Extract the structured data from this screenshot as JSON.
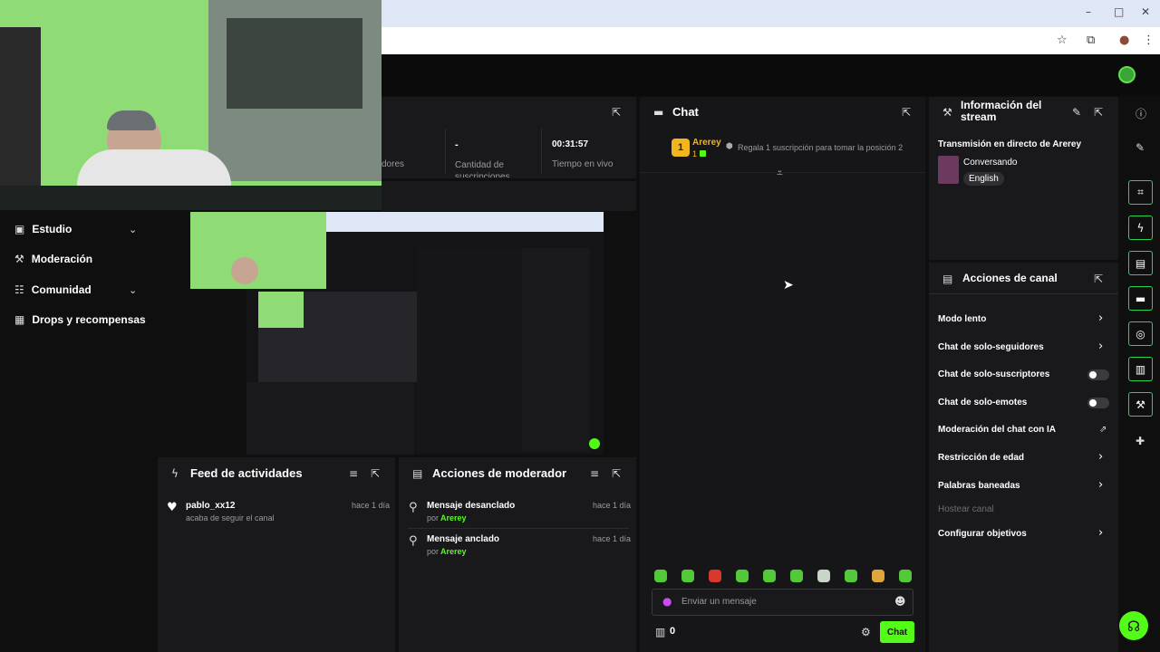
{
  "browser": {
    "window_controls": [
      "–",
      "□",
      "✕"
    ],
    "toolbar_icons": [
      "☆",
      "⧉",
      "●",
      "⋮"
    ]
  },
  "sidebar": {
    "items": [
      {
        "label": "Estudio",
        "icon": "camera-icon",
        "expandable": true
      },
      {
        "label": "Moderación",
        "icon": "wrench-icon",
        "expandable": false
      },
      {
        "label": "Comunidad",
        "icon": "users-icon",
        "expandable": true
      },
      {
        "label": "Drops y recompensas",
        "icon": "gift-icon",
        "expandable": false
      }
    ]
  },
  "stats": {
    "followers_label": "dores",
    "subs_value": "-",
    "subs_label": "Cantidad de suscripciones",
    "time_value": "00:31:57",
    "time_label": "Tiempo en vivo"
  },
  "chat": {
    "title": "Chat",
    "leader": {
      "rank": "1",
      "name": "Arerey",
      "count": "1"
    },
    "gift_text": "Regala 1 suscripción para tomar la posición 2",
    "input_placeholder": "Enviar un mensaje",
    "points": "0",
    "send_label": "Chat"
  },
  "stream_info": {
    "title": "Información del stream",
    "heading": "Transmisión en directo de Arerey",
    "category": "Conversando",
    "language": "English"
  },
  "channel_actions": {
    "title": "Acciones de canal",
    "items": [
      {
        "label": "Modo lento",
        "control": "arrow"
      },
      {
        "label": "Chat de solo-seguidores",
        "control": "arrow"
      },
      {
        "label": "Chat de solo-suscriptores",
        "control": "toggle"
      },
      {
        "label": "Chat de solo-emotes",
        "control": "toggle"
      },
      {
        "label": "Moderación del chat con IA",
        "control": "external"
      },
      {
        "label": "Restricción de edad",
        "control": "arrow"
      },
      {
        "label": "Palabras baneadas",
        "control": "arrow"
      },
      {
        "label": "Hostear canal",
        "control": "disabled"
      },
      {
        "label": "Configurar objetivos",
        "control": "arrow"
      }
    ]
  },
  "activity_feed": {
    "title": "Feed de actividades",
    "items": [
      {
        "user": "pablo_xx12",
        "text": "acaba de seguir el canal",
        "time": "hace 1 día"
      }
    ]
  },
  "mod_actions": {
    "title": "Acciones de moderador",
    "items": [
      {
        "action": "Mensaje desanclado",
        "by_label": "por",
        "by": "Arerey",
        "time": "hace 1 día"
      },
      {
        "action": "Mensaje anclado",
        "by_label": "por",
        "by": "Arerey",
        "time": "hace 1 día"
      }
    ]
  },
  "colors": {
    "accent": "#53fc18",
    "bg": "#0f0f10",
    "panel": "#19191b"
  }
}
